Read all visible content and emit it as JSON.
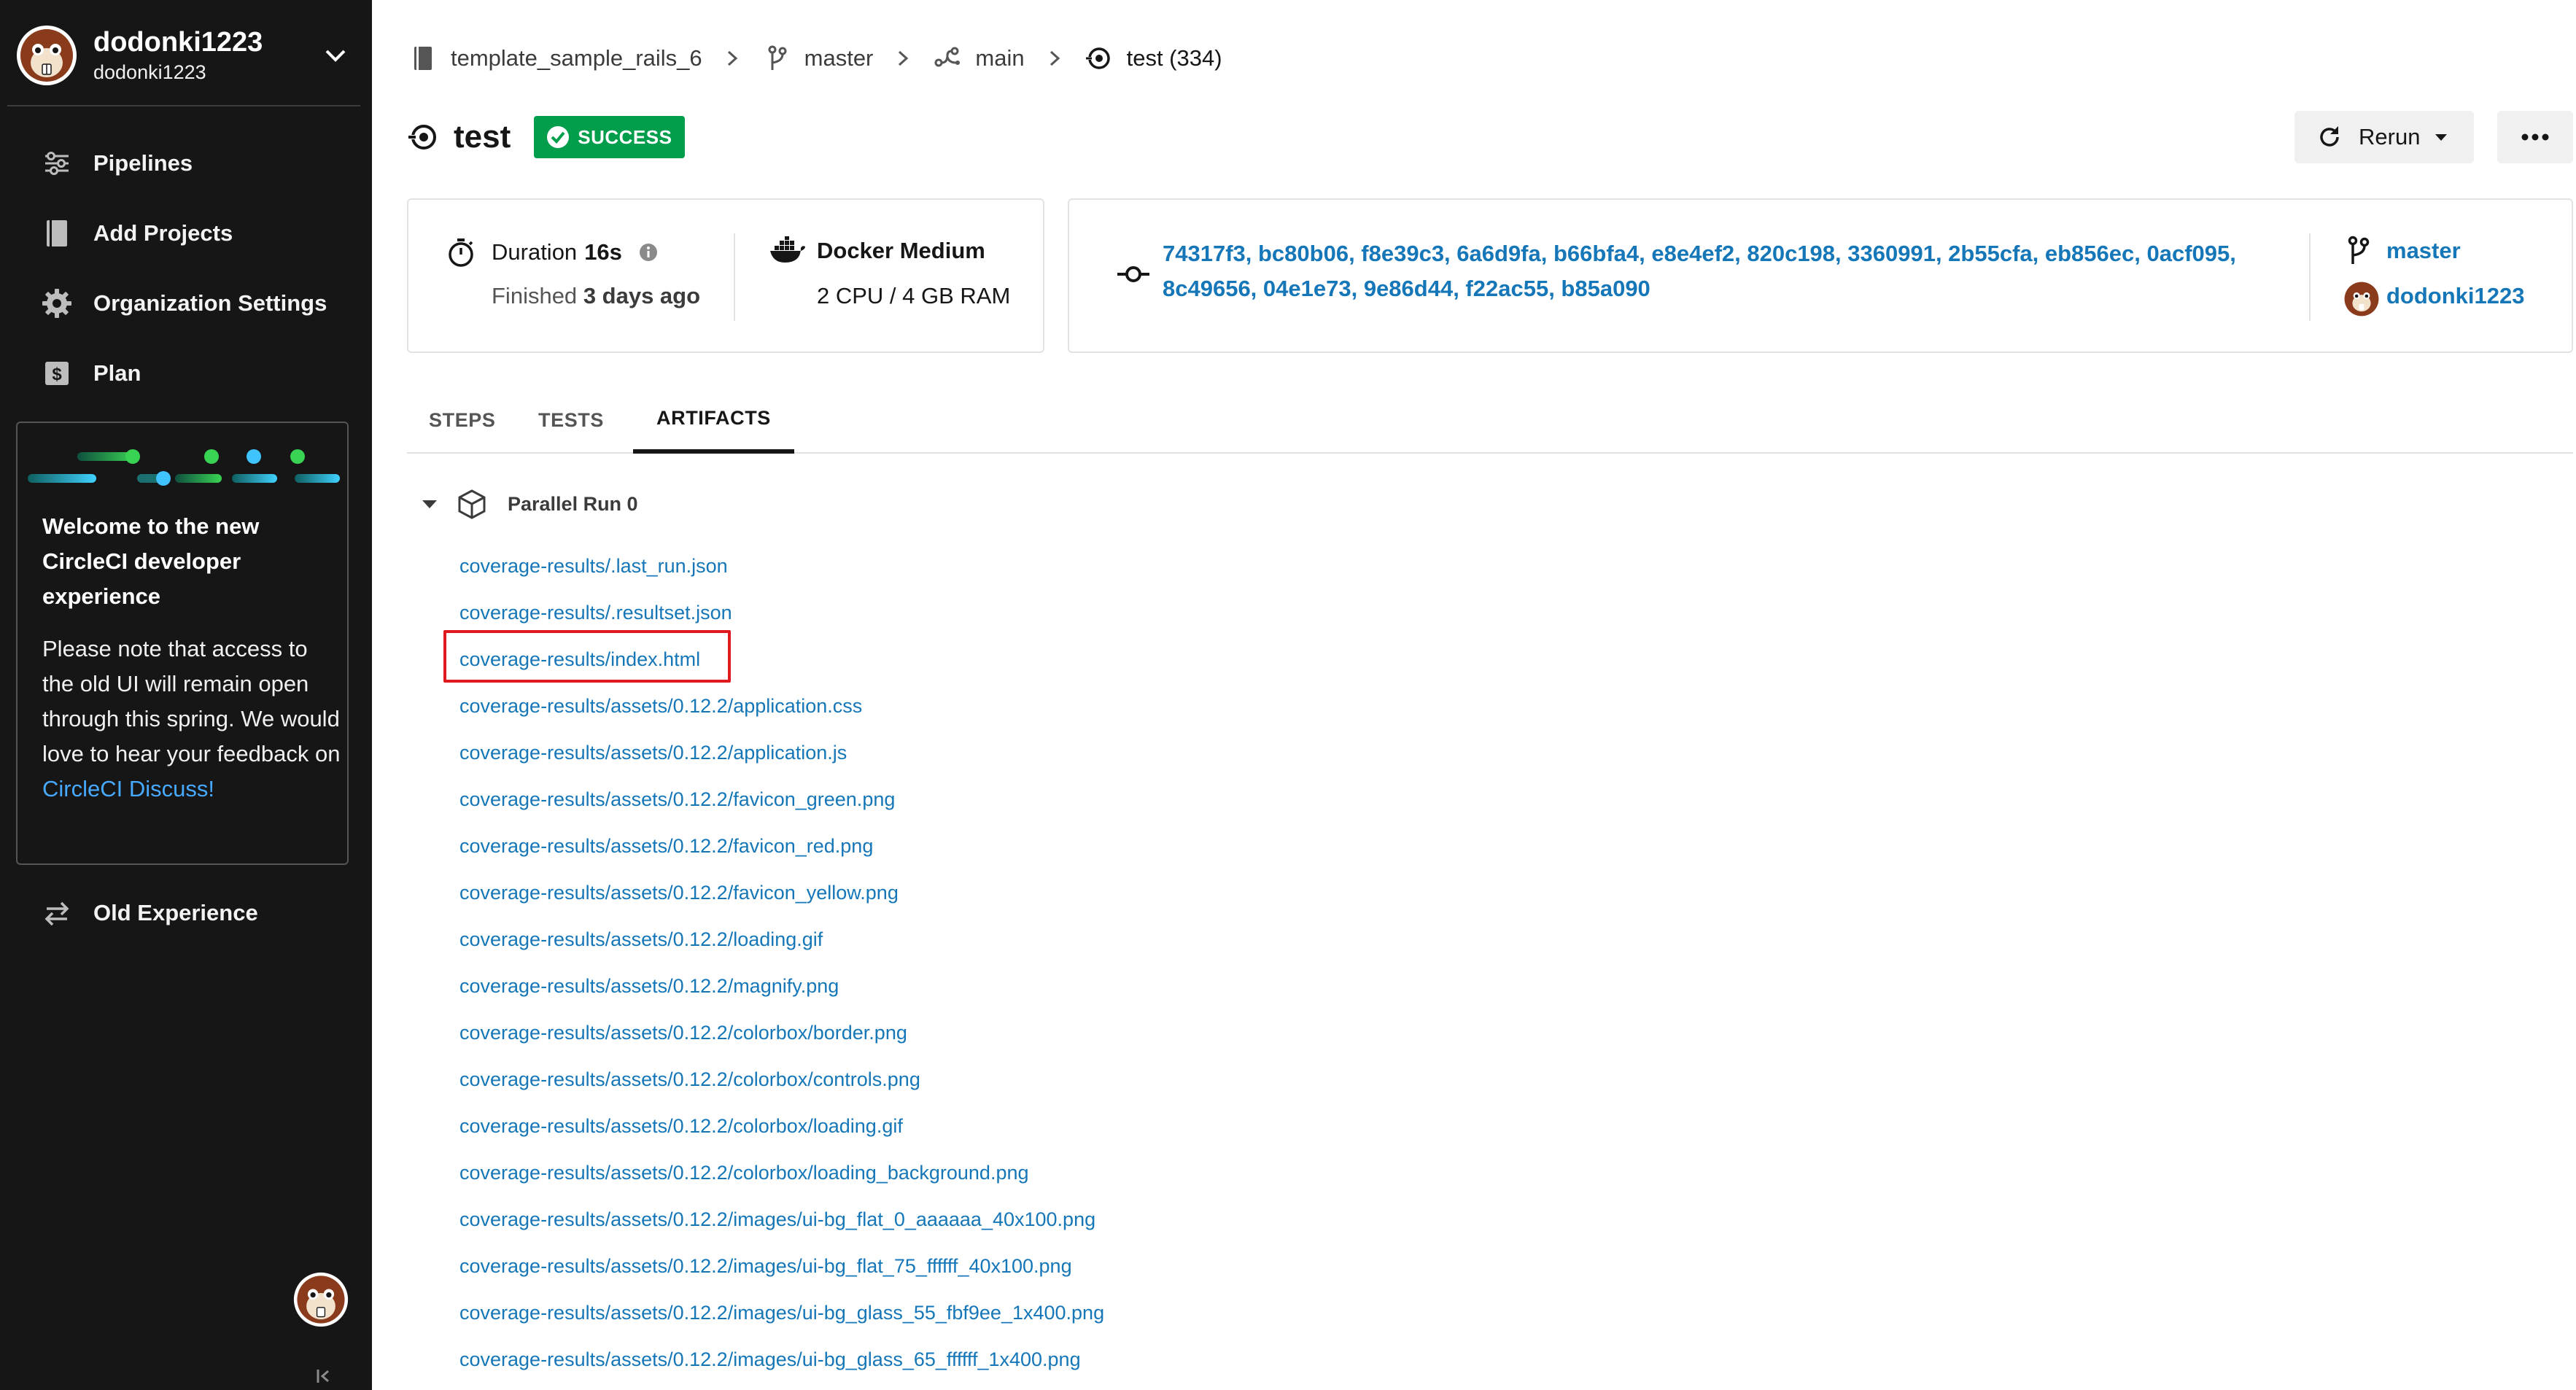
{
  "org": {
    "name": "dodonki1223",
    "handle": "dodonki1223"
  },
  "sidebar": {
    "items": [
      {
        "label": "Pipelines",
        "icon": "pipelines-icon"
      },
      {
        "label": "Add Projects",
        "icon": "book-icon"
      },
      {
        "label": "Organization Settings",
        "icon": "gear-icon"
      },
      {
        "label": "Plan",
        "icon": "dollar-icon"
      }
    ],
    "welcome": {
      "title": "Welcome to the new CircleCI developer experience",
      "body": "Please note that access to the old UI will remain open through this spring. We would love to hear your feedback on ",
      "link": "CircleCI Discuss!"
    },
    "old_experience": "Old Experience"
  },
  "breadcrumb": {
    "project": "template_sample_rails_6",
    "branch": "master",
    "workflow": "main",
    "job": "test (334)"
  },
  "job": {
    "title": "test",
    "status": "SUCCESS",
    "rerun_label": "Rerun"
  },
  "summary": {
    "duration_label": "Duration",
    "duration_value": "16s",
    "finished_label": "Finished",
    "finished_value": "3 days ago",
    "executor": "Docker Medium",
    "resources": "2 CPU / 4 GB RAM",
    "commits_line1": "74317f3, bc80b06, f8e39c3, 6a6d9fa, b66bfa4, e8e4ef2, 820c198, 3360991, 2b55cfa, eb856ec, 0acf095,",
    "commits_line2": "8c49656, 04e1e73, 9e86d44, f22ac55, b85a090",
    "branch": "master",
    "user": "dodonki1223"
  },
  "tabs": [
    {
      "label": "STEPS",
      "active": false
    },
    {
      "label": "TESTS",
      "active": false
    },
    {
      "label": "ARTIFACTS",
      "active": true
    }
  ],
  "artifacts": {
    "group_label": "Parallel Run 0",
    "files": [
      "coverage-results/.last_run.json",
      "coverage-results/.resultset.json",
      "coverage-results/index.html",
      "coverage-results/assets/0.12.2/application.css",
      "coverage-results/assets/0.12.2/application.js",
      "coverage-results/assets/0.12.2/favicon_green.png",
      "coverage-results/assets/0.12.2/favicon_red.png",
      "coverage-results/assets/0.12.2/favicon_yellow.png",
      "coverage-results/assets/0.12.2/loading.gif",
      "coverage-results/assets/0.12.2/magnify.png",
      "coverage-results/assets/0.12.2/colorbox/border.png",
      "coverage-results/assets/0.12.2/colorbox/controls.png",
      "coverage-results/assets/0.12.2/colorbox/loading.gif",
      "coverage-results/assets/0.12.2/colorbox/loading_background.png",
      "coverage-results/assets/0.12.2/images/ui-bg_flat_0_aaaaaa_40x100.png",
      "coverage-results/assets/0.12.2/images/ui-bg_flat_75_ffffff_40x100.png",
      "coverage-results/assets/0.12.2/images/ui-bg_glass_55_fbf9ee_1x400.png",
      "coverage-results/assets/0.12.2/images/ui-bg_glass_65_ffffff_1x400.png"
    ]
  },
  "colors": {
    "sidebar_bg": "#161616",
    "link": "#1576b8",
    "success": "#029e4c",
    "highlight": "#e0191e"
  }
}
